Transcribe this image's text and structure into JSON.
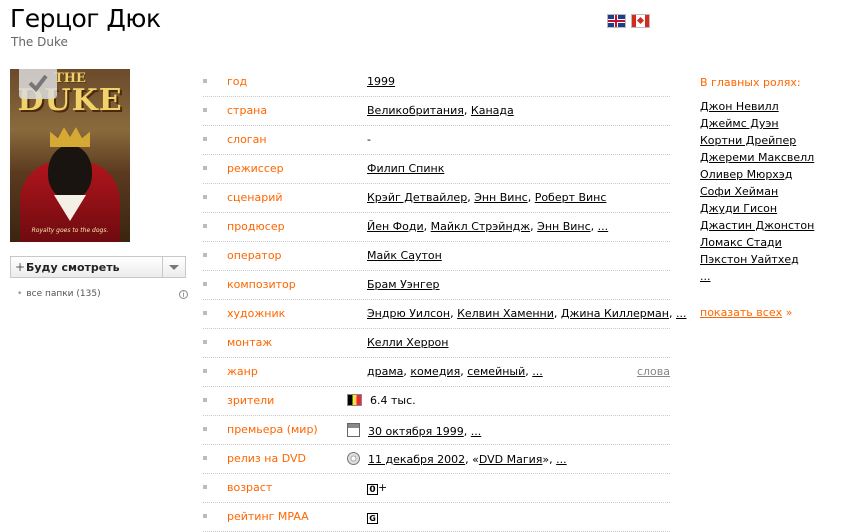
{
  "movie": {
    "title": "Герцог Дюк",
    "original_title": "The Duke"
  },
  "poster": {
    "text_top": "THE",
    "text_main": "DUKE",
    "tagline": "Royalty goes to the dogs."
  },
  "watch": {
    "label": "Буду смотреть",
    "folders": "все папки (135)"
  },
  "info": {
    "rows": [
      {
        "label": "год",
        "value": [
          "1999"
        ]
      },
      {
        "label": "страна",
        "value": [
          "Великобритания",
          "Канада"
        ]
      },
      {
        "label": "слоган",
        "text": "-"
      },
      {
        "label": "режиссер",
        "value": [
          "Филип Спинк"
        ]
      },
      {
        "label": "сценарий",
        "value": [
          "Крэйг Детвайлер",
          "Энн Винс",
          "Роберт Винс"
        ]
      },
      {
        "label": "продюсер",
        "value": [
          "Йен Фоди",
          "Майкл Стрэйндж",
          "Энн Винс",
          "..."
        ]
      },
      {
        "label": "оператор",
        "value": [
          "Майк Саутон"
        ]
      },
      {
        "label": "композитор",
        "value": [
          "Брам Уэнгер"
        ]
      },
      {
        "label": "художник",
        "value": [
          "Эндрю Уилсон",
          "Келвин Хаменни",
          "Джина Киллерман",
          "..."
        ]
      },
      {
        "label": "монтаж",
        "value": [
          "Келли Херрон"
        ]
      },
      {
        "label": "жанр",
        "value": [
          "драма",
          "комедия",
          "семейный",
          "..."
        ],
        "extra": "слова"
      },
      {
        "label": "зрители",
        "text": "6.4 тыс."
      },
      {
        "label": "премьера (мир)",
        "value": [
          "30 октября 1999",
          "..."
        ]
      },
      {
        "label": "релиз на DVD",
        "value": [
          "11 декабря 2002",
          "DVD Магия",
          "..."
        ]
      },
      {
        "label": "возраст",
        "age": "0",
        "age_suffix": "+"
      },
      {
        "label": "рейтинг MPAA",
        "mpaa": "G"
      }
    ]
  },
  "cast": {
    "heading": "В главных ролях:",
    "actors": [
      "Джон Невилл",
      "Джеймс Дуэн",
      "Кортни Дрейпер",
      "Джереми Максвелл",
      "Оливер Мюрхэд",
      "Софи Хейман",
      "Джуди Гисон",
      "Джастин Джонстон",
      "Ломакс Стади",
      "Пэкстон Уайтхед",
      "..."
    ],
    "show_all": "показать всех",
    "show_all_arrow": "»"
  },
  "colors": {
    "accent": "#ff6600",
    "link": "#000000"
  }
}
